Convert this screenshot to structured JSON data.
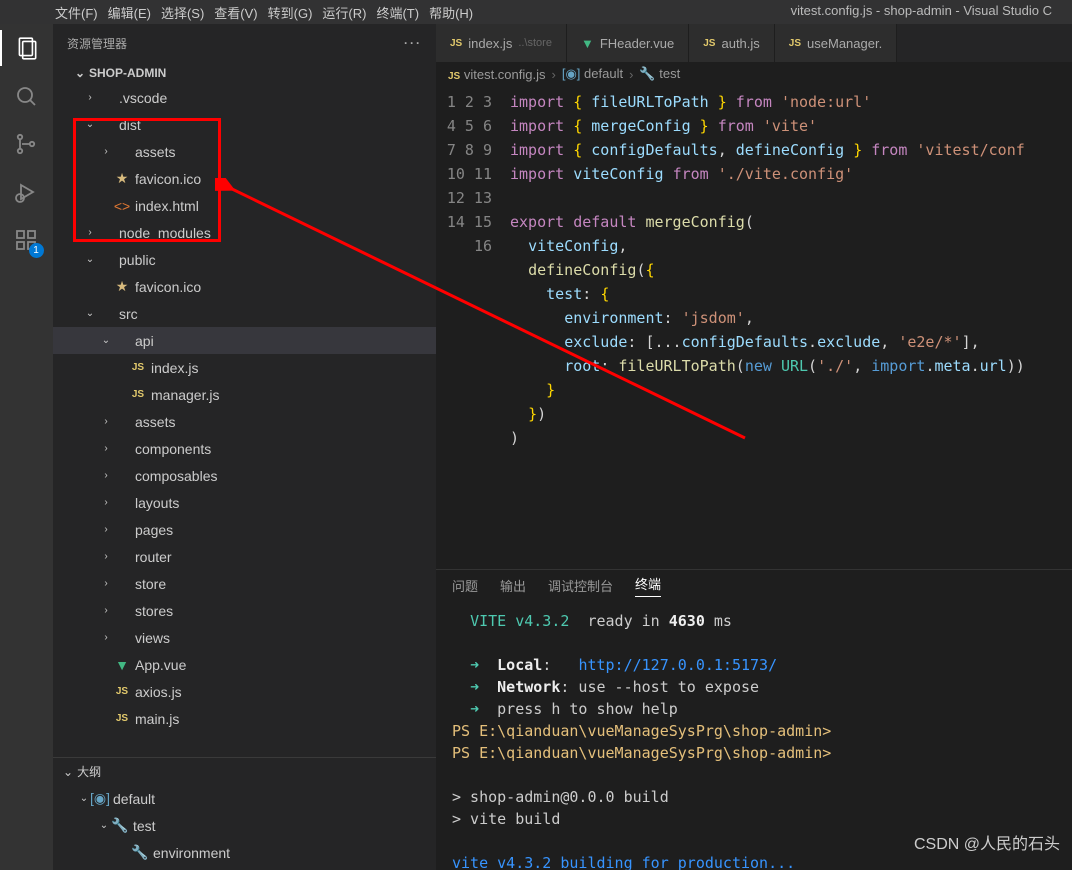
{
  "title_right": "vitest.config.js - shop-admin - Visual Studio C",
  "menu": [
    "文件(F)",
    "编辑(E)",
    "选择(S)",
    "查看(V)",
    "转到(G)",
    "运行(R)",
    "终端(T)",
    "帮助(H)"
  ],
  "sidebar_title": "资源管理器",
  "project_name": "SHOP-ADMIN",
  "activity_badge": "1",
  "tree": [
    {
      "depth": 0,
      "chev": "›",
      "ico": "",
      "label": ".vscode"
    },
    {
      "depth": 0,
      "chev": "⌄",
      "ico": "",
      "label": "dist"
    },
    {
      "depth": 1,
      "chev": "›",
      "ico": "",
      "label": "assets"
    },
    {
      "depth": 1,
      "chev": "",
      "ico": "star",
      "label": "favicon.ico"
    },
    {
      "depth": 1,
      "chev": "",
      "ico": "orange",
      "label": "index.html"
    },
    {
      "depth": 0,
      "chev": "›",
      "ico": "",
      "label": "node_modules"
    },
    {
      "depth": 0,
      "chev": "⌄",
      "ico": "",
      "label": "public"
    },
    {
      "depth": 1,
      "chev": "",
      "ico": "star",
      "label": "favicon.ico"
    },
    {
      "depth": 0,
      "chev": "⌄",
      "ico": "",
      "label": "src"
    },
    {
      "depth": 1,
      "chev": "⌄",
      "ico": "",
      "label": "api",
      "sel": true
    },
    {
      "depth": 2,
      "chev": "",
      "ico": "js",
      "label": "index.js"
    },
    {
      "depth": 2,
      "chev": "",
      "ico": "js",
      "label": "manager.js"
    },
    {
      "depth": 1,
      "chev": "›",
      "ico": "",
      "label": "assets"
    },
    {
      "depth": 1,
      "chev": "›",
      "ico": "",
      "label": "components"
    },
    {
      "depth": 1,
      "chev": "›",
      "ico": "",
      "label": "composables"
    },
    {
      "depth": 1,
      "chev": "›",
      "ico": "",
      "label": "layouts"
    },
    {
      "depth": 1,
      "chev": "›",
      "ico": "",
      "label": "pages"
    },
    {
      "depth": 1,
      "chev": "›",
      "ico": "",
      "label": "router"
    },
    {
      "depth": 1,
      "chev": "›",
      "ico": "",
      "label": "store"
    },
    {
      "depth": 1,
      "chev": "›",
      "ico": "",
      "label": "stores"
    },
    {
      "depth": 1,
      "chev": "›",
      "ico": "",
      "label": "views"
    },
    {
      "depth": 1,
      "chev": "",
      "ico": "vue",
      "label": "App.vue"
    },
    {
      "depth": 1,
      "chev": "",
      "ico": "js",
      "label": "axios.js"
    },
    {
      "depth": 1,
      "chev": "",
      "ico": "js",
      "label": "main.js"
    }
  ],
  "outline_title": "大纲",
  "outline": [
    {
      "depth": 0,
      "chev": "⌄",
      "ico": "cube",
      "label": "default"
    },
    {
      "depth": 1,
      "chev": "⌄",
      "ico": "wrench",
      "label": "test"
    },
    {
      "depth": 2,
      "chev": "",
      "ico": "wrench",
      "label": "environment"
    }
  ],
  "tabs": [
    {
      "ico": "js",
      "label": "index.js",
      "hint": "..\\store",
      "active": false
    },
    {
      "ico": "vue",
      "label": "FHeader.vue",
      "hint": "",
      "active": false
    },
    {
      "ico": "js",
      "label": "auth.js",
      "hint": "",
      "active": false
    },
    {
      "ico": "js",
      "label": "useManager.",
      "hint": "",
      "active": false
    }
  ],
  "crumbs": [
    {
      "ico": "js",
      "label": "vitest.config.js"
    },
    {
      "ico": "cube",
      "label": "default"
    },
    {
      "ico": "wrench",
      "label": "test"
    }
  ],
  "code_line_start": 1,
  "code_line_end": 16,
  "term_tabs": [
    "问题",
    "输出",
    "调试控制台",
    "终端"
  ],
  "term_active": "终端",
  "term": {
    "vite_ver": "VITE v4.3.2",
    "ready": "ready in",
    "ms": "4630",
    "ms_unit": "ms",
    "local_label": "Local",
    "local_url": "http://127.0.0.1:5173/",
    "net_label": "Network",
    "net_text": ": use --host to expose",
    "press": "press h to show help",
    "ps1": "PS E:\\qianduan\\vueManageSysPrg\\shop-admin>",
    "ps2": "PS E:\\qianduan\\vueManageSysPrg\\shop-admin>",
    "build1": "> shop-admin@0.0.0 build",
    "build2": "> vite build",
    "building": "vite v4.3.2 building for production..."
  },
  "watermark": "CSDN @人民的石头"
}
